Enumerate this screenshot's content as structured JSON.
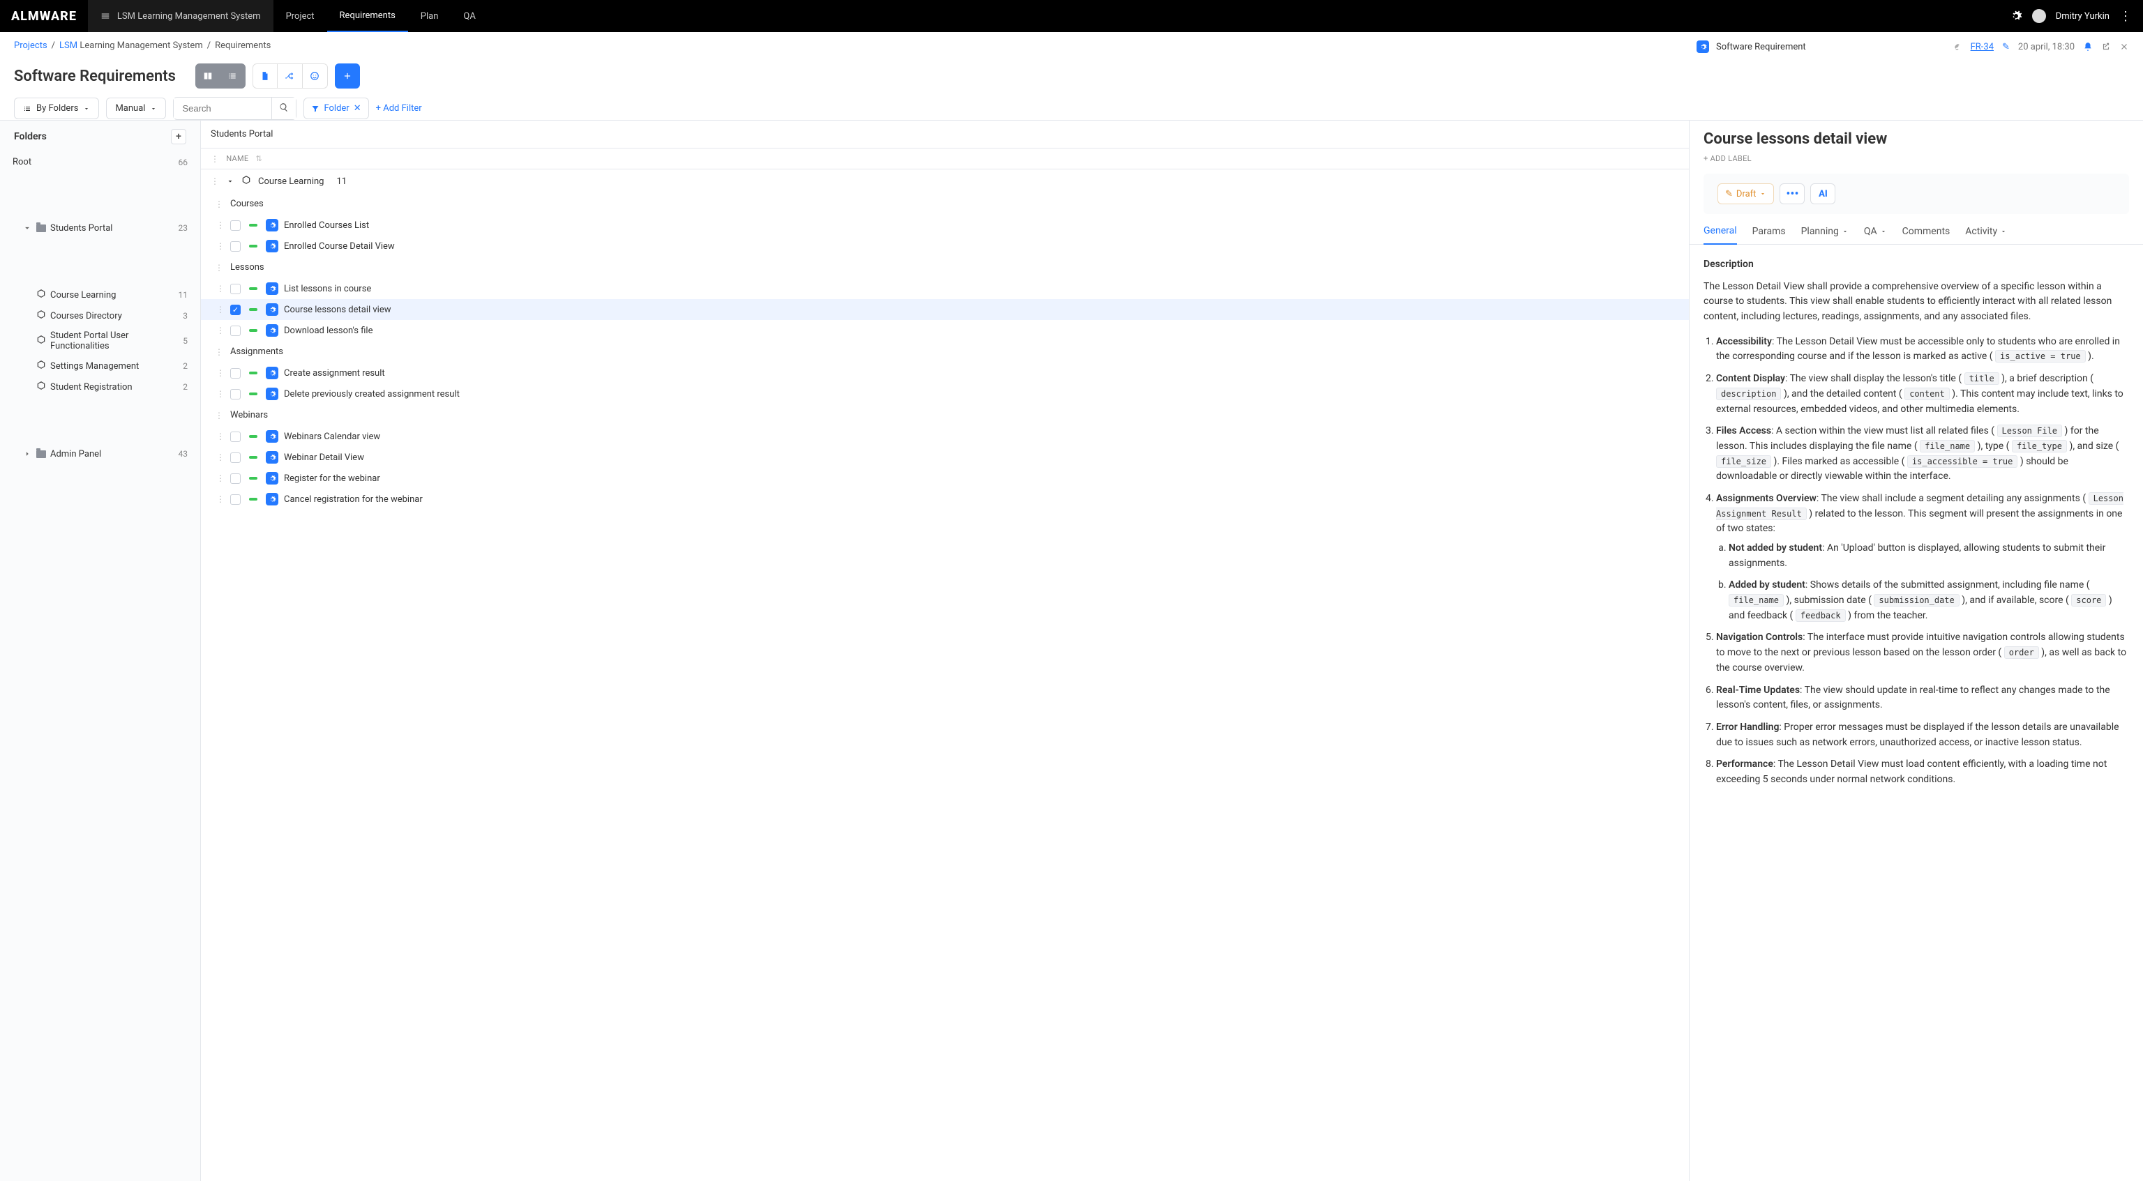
{
  "app": {
    "logo": "ALMWARE"
  },
  "topbar": {
    "project_label": "LSM Learning Management System",
    "nav": {
      "project": "Project",
      "requirements": "Requirements",
      "plan": "Plan",
      "qa": "QA"
    },
    "user_name": "Dmitry Yurkin"
  },
  "breadcrumb": {
    "projects": "Projects",
    "lsm_short": "LSM",
    "lsm_rest": "Learning Management System",
    "requirements": "Requirements"
  },
  "page": {
    "title": "Software Requirements"
  },
  "filters": {
    "by_folders": "By Folders",
    "manual": "Manual",
    "search_placeholder": "Search",
    "folder_chip": "Folder",
    "add_filter": "+ Add Filter"
  },
  "sidebar": {
    "header": "Folders",
    "root": {
      "name": "Root",
      "count": "66"
    },
    "students_portal": {
      "name": "Students Portal",
      "count": "23"
    },
    "items": {
      "course_learning": {
        "name": "Course Learning",
        "count": "11"
      },
      "courses_directory": {
        "name": "Courses Directory",
        "count": "3"
      },
      "user_func": {
        "name": "Student Portal User Functionalities",
        "count": "5"
      },
      "settings_mgmt": {
        "name": "Settings Management",
        "count": "2"
      },
      "student_reg": {
        "name": "Student Registration",
        "count": "2"
      }
    },
    "admin_panel": {
      "name": "Admin Panel",
      "count": "43"
    }
  },
  "list": {
    "header": "Students Portal",
    "colhead_name": "NAME",
    "group": {
      "name": "Course Learning",
      "count": "11"
    },
    "subgroups": {
      "courses": "Courses",
      "lessons": "Lessons",
      "assignments": "Assignments",
      "webinars": "Webinars"
    },
    "items": {
      "enrolled_list": "Enrolled Courses List",
      "enrolled_detail": "Enrolled Course Detail View",
      "list_lessons": "List lessons in course",
      "lessons_detail": "Course lessons detail view",
      "download_lesson": "Download lesson's file",
      "create_assign": "Create assignment result",
      "delete_assign": "Delete previously created assignment result",
      "webinars_cal": "Webinars Calendar view",
      "webinar_detail": "Webinar Detail View",
      "register_webinar": "Register for the webinar",
      "cancel_webinar": "Cancel registration for the webinar"
    }
  },
  "detail": {
    "pre_icon_label": "Software Requirement",
    "id": "FR-34",
    "date": "20 april, 18:30",
    "title": "Course lessons detail view",
    "add_label": "+ ADD LABEL",
    "draft": "Draft",
    "ai": "AI",
    "tabs": {
      "general": "General",
      "params": "Params",
      "planning": "Planning",
      "qa": "QA",
      "comments": "Comments",
      "activity": "Activity"
    },
    "description_heading": "Description",
    "intro": "The Lesson Detail View shall provide a comprehensive overview of a specific lesson within a course to students. This view shall enable students to efficiently interact with all related lesson content, including lectures, readings, assignments, and any associated files.",
    "li1_strong": "Accessibility",
    "li1_text": ": The Lesson Detail View must be accessible only to students who are enrolled in the corresponding course and if the lesson is marked as active ( ",
    "li1_code": "is_active = true",
    "li1_after": " ).",
    "li2_strong": "Content Display",
    "li2_t1": ": The view shall display the lesson's title ( ",
    "li2_c1": "title",
    "li2_t2": " ), a brief description ( ",
    "li2_c2": "description",
    "li2_t3": " ), and the detailed content ( ",
    "li2_c3": "content",
    "li2_t4": " ). This content may include text, links to external resources, embedded videos, and other multimedia elements.",
    "li3_strong": "Files Access",
    "li3_t1": ": A section within the view must list all related files ( ",
    "li3_c1": "Lesson File",
    "li3_t2": " ) for the lesson. This includes displaying the file name ( ",
    "li3_c2": "file_name",
    "li3_t3": " ), type ( ",
    "li3_c3": "file_type",
    "li3_t4": " ), and size ( ",
    "li3_c4": "file_size",
    "li3_t5": " ). Files marked as accessible ( ",
    "li3_c5": "is_accessible = true",
    "li3_t6": " ) should be downloadable or directly viewable within the interface.",
    "li4_strong": "Assignments Overview",
    "li4_t1": ": The view shall include a segment detailing any assignments ( ",
    "li4_c1": "Lesson Assignment Result",
    "li4_t2": " ) related to the lesson. This segment will present the assignments in one of two states:",
    "li4a_strong": "Not added by student",
    "li4a_text": ": An 'Upload' button is displayed, allowing students to submit their assignments.",
    "li4b_strong": "Added by student",
    "li4b_t1": ": Shows details of the submitted assignment, including file name ( ",
    "li4b_c1": "file_name",
    "li4b_t2": " ), submission date ( ",
    "li4b_c2": "submission_date",
    "li4b_t3": " ), and if available, score ( ",
    "li4b_c3": "score",
    "li4b_t4": " ) and feedback ( ",
    "li4b_c4": "feedback",
    "li4b_t5": " ) from the teacher.",
    "li5_strong": "Navigation Controls",
    "li5_t1": ": The interface must provide intuitive navigation controls allowing students to move to the next or previous lesson based on the lesson order ( ",
    "li5_c1": "order",
    "li5_t2": " ), as well as back to the course overview.",
    "li6_strong": "Real-Time Updates",
    "li6_text": ": The view should update in real-time to reflect any changes made to the lesson's content, files, or assignments.",
    "li7_strong": "Error Handling",
    "li7_text": ": Proper error messages must be displayed if the lesson details are unavailable due to issues such as network errors, unauthorized access, or inactive lesson status.",
    "li8_strong": "Performance",
    "li8_text": ": The Lesson Detail View must load content efficiently, with a loading time not exceeding 5 seconds under normal network conditions."
  }
}
